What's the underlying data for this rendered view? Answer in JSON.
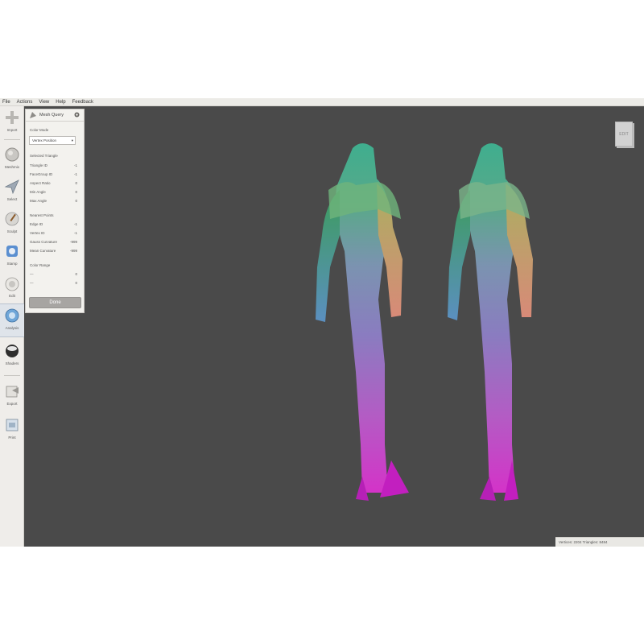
{
  "menu": [
    "File",
    "Actions",
    "View",
    "Help",
    "Feedback"
  ],
  "tools": [
    {
      "label": "Import",
      "icon": "plus-icon"
    },
    {
      "label": "Meshmix",
      "icon": "meshmix-icon"
    },
    {
      "label": "Select",
      "icon": "select-arrow-icon"
    },
    {
      "label": "Sculpt",
      "icon": "brush-icon"
    },
    {
      "label": "Stamp",
      "icon": "stamp-icon"
    },
    {
      "label": "Edit",
      "icon": "edit-icon"
    },
    {
      "label": "Analysis",
      "icon": "analysis-icon",
      "active": true
    },
    {
      "label": "Shaders",
      "icon": "shaders-icon"
    },
    {
      "label": "Export",
      "icon": "export-icon"
    },
    {
      "label": "Print",
      "icon": "print-icon"
    }
  ],
  "panel": {
    "title": "Mesh Query",
    "color_mode_label": "Color Mode",
    "color_mode_value": "Vertex Position",
    "selected_triangle_label": "Selected Triangle",
    "triangle_rows": [
      {
        "label": "Triangle ID",
        "value": "-1"
      },
      {
        "label": "FaceGroup ID",
        "value": "-1"
      },
      {
        "label": "Aspect Ratio",
        "value": "0"
      },
      {
        "label": "Min Angle",
        "value": "0"
      },
      {
        "label": "Max Angle",
        "value": "0"
      }
    ],
    "nearest_points_label": "Nearest Points",
    "nearest_rows": [
      {
        "label": "Edge ID",
        "value": "-1"
      },
      {
        "label": "Vertex ID",
        "value": "-1"
      },
      {
        "label": "Gauss Curvature",
        "value": "-999"
      },
      {
        "label": "Mean Curvature",
        "value": "-999"
      }
    ],
    "color_range_label": "Color Range",
    "range_rows": [
      {
        "label": "—",
        "value": "0"
      },
      {
        "label": "—",
        "value": "0"
      }
    ],
    "done_label": "Done"
  },
  "view_cube_label": "EDIT",
  "status_text": "Vertices: 2204 Triangles: 8484"
}
